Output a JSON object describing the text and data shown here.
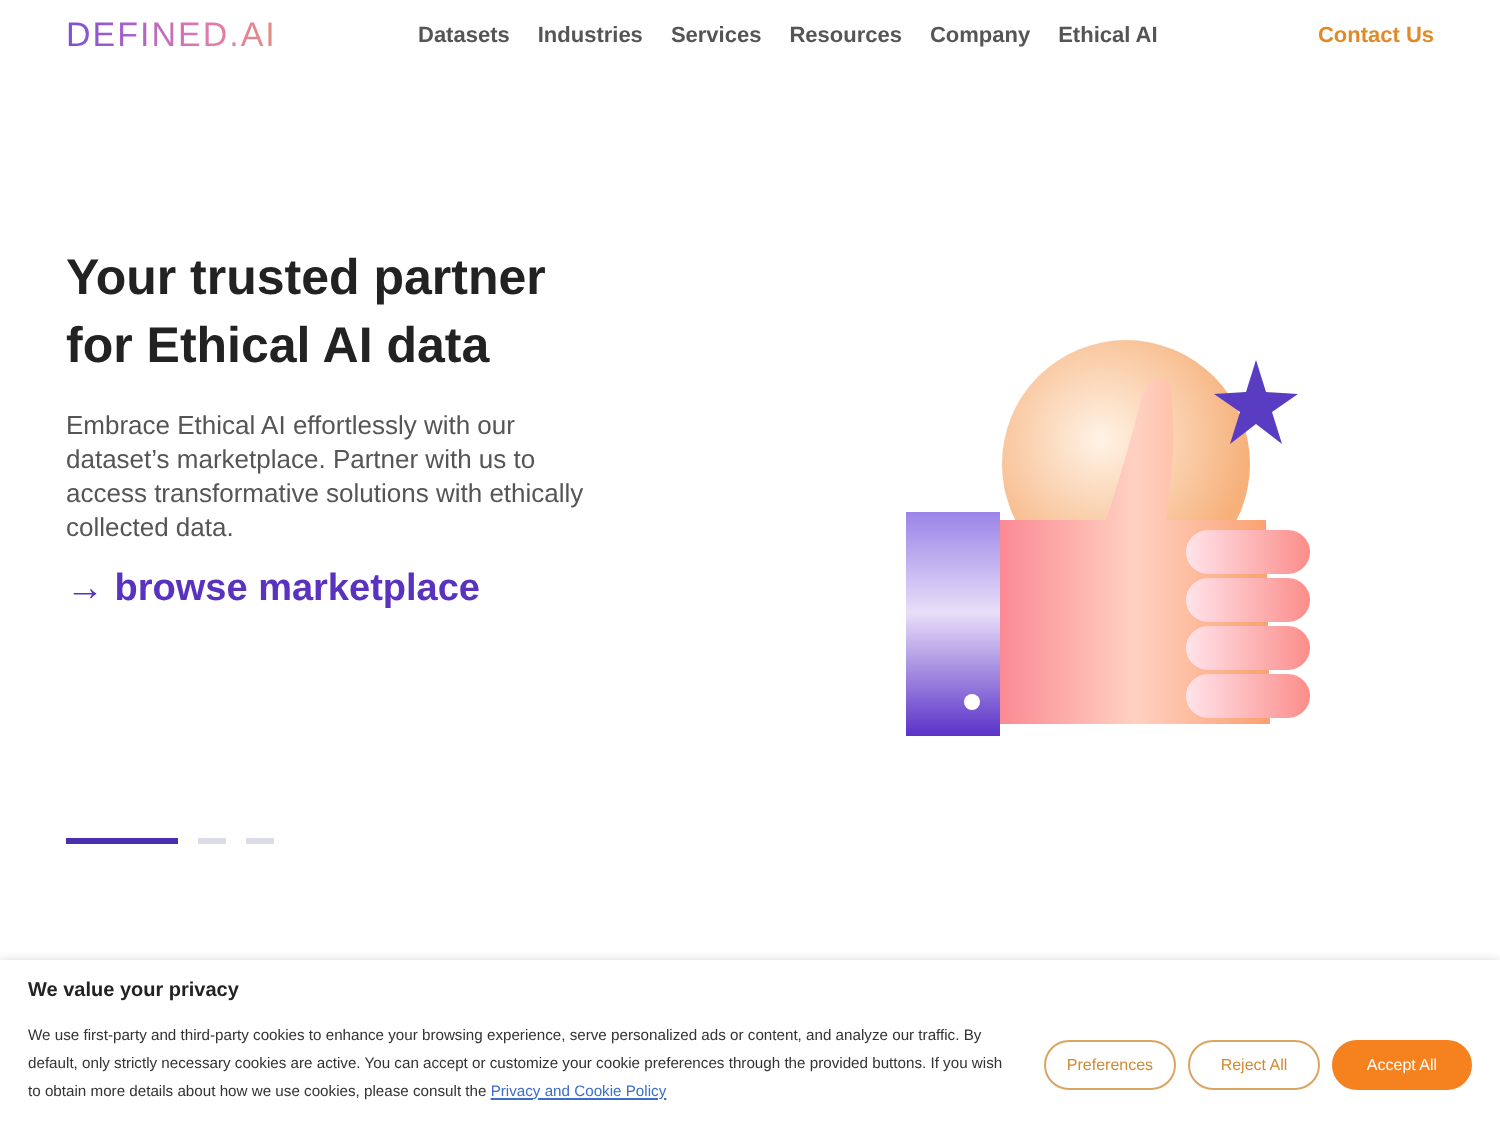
{
  "header": {
    "logo": "DEFINED.AI",
    "nav": [
      {
        "label": "Datasets"
      },
      {
        "label": "Industries"
      },
      {
        "label": "Services"
      },
      {
        "label": "Resources"
      },
      {
        "label": "Company"
      },
      {
        "label": "Ethical AI"
      }
    ],
    "contact": "Contact Us"
  },
  "hero": {
    "title_lines": [
      "Your trusted partner",
      "for Ethical AI data"
    ],
    "text": "Embrace Ethical AI effortlessly with our dataset’s marketplace. Partner with us to access transformative solutions with ethically collected data.",
    "link": "browse marketplace",
    "link_arrow": "→"
  },
  "carousel": [
    {
      "selected": true
    },
    {
      "selected": false
    },
    {
      "selected": false
    }
  ],
  "cookie_banner": {
    "title": "We value your privacy",
    "text": "We use first-party and third-party cookies to enhance your browsing experience, serve personalized ads or content, and analyze our traffic. By default, only strictly necessary cookies are active. You can accept or customize your cookie preferences through the provided buttons. If you wish to obtain more details about how we use cookies, please consult the",
    "policy_link": "Privacy and Cookie Policy",
    "buttons": [
      {
        "label": "Preferences",
        "kind": "outline"
      },
      {
        "label": "Reject All",
        "kind": "outline"
      },
      {
        "label": "Accept All",
        "kind": "filled"
      }
    ]
  }
}
